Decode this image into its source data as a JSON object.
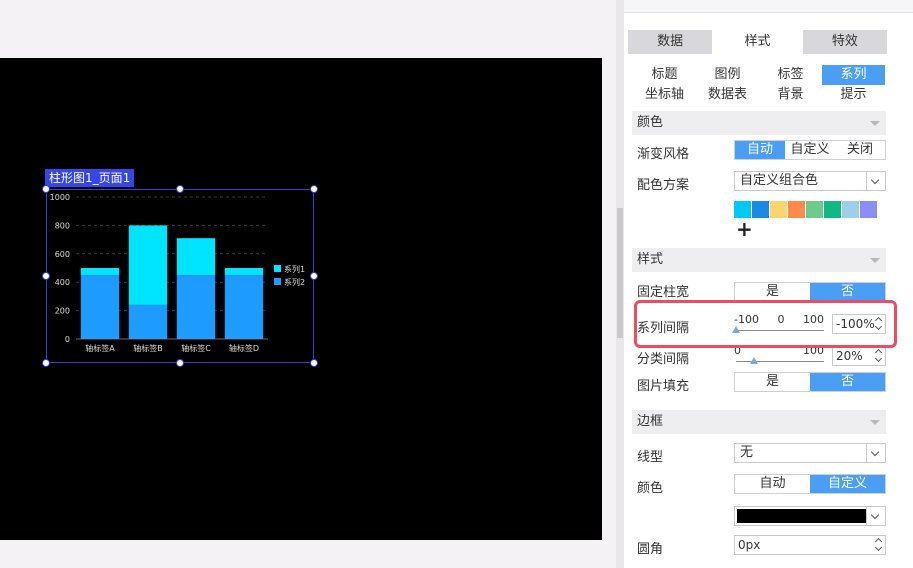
{
  "selection_tag": "柱形图1_页面1",
  "chart_data": {
    "type": "bar",
    "categories": [
      "轴标签A",
      "轴标签B",
      "轴标签C",
      "轴标签D"
    ],
    "series": [
      {
        "name": "系列1",
        "values": [
          50,
          560,
          260,
          50
        ],
        "color": "#00e5ff"
      },
      {
        "name": "系列2",
        "values": [
          450,
          240,
          450,
          450
        ],
        "color": "#1e9bff"
      }
    ],
    "stacked": true,
    "ylim": [
      0,
      1000
    ],
    "yticks": [
      "0",
      "200",
      "400",
      "600",
      "800",
      "1000"
    ],
    "grid": true,
    "legend": "right",
    "title": "",
    "xlabel": "",
    "ylabel": ""
  },
  "panel": {
    "main_tabs": [
      "数据",
      "样式",
      "特效"
    ],
    "sub_tabs": [
      "标题",
      "图例",
      "标签",
      "系列",
      "坐标轴",
      "数据表",
      "背景",
      "提示"
    ],
    "color_section": {
      "title": "颜色",
      "gradient_label": "渐变风格",
      "gradient_options": [
        "自动",
        "自定义",
        "关闭"
      ],
      "scheme_label": "配色方案",
      "scheme_value": "自定义组合色",
      "swatches": [
        "#00c8f8",
        "#1e88e5",
        "#f9d56e",
        "#ff8a4c",
        "#6ccb8e",
        "#10b981",
        "#9ecfe9",
        "#8b8ef6"
      ],
      "add_symbol": "+"
    },
    "style_section": {
      "title": "样式",
      "fixed_width_label": "固定柱宽",
      "yes": "是",
      "no": "否",
      "series_gap_label": "系列间隔",
      "series_gap_ticks": [
        "-100",
        "0",
        "100"
      ],
      "series_gap_value": "-100%",
      "series_gap_level": 0,
      "category_gap_label": "分类间隔",
      "category_gap_ticks": [
        "0",
        "100"
      ],
      "category_gap_value": "20%",
      "category_gap_level": 0.2,
      "image_fill_label": "图片填充"
    },
    "border_section": {
      "title": "边框",
      "line_type_label": "线型",
      "line_type_value": "无",
      "color_label": "颜色",
      "color_options": [
        "自动",
        "自定义"
      ],
      "radius_label": "圆角",
      "radius_value": "0px"
    }
  }
}
